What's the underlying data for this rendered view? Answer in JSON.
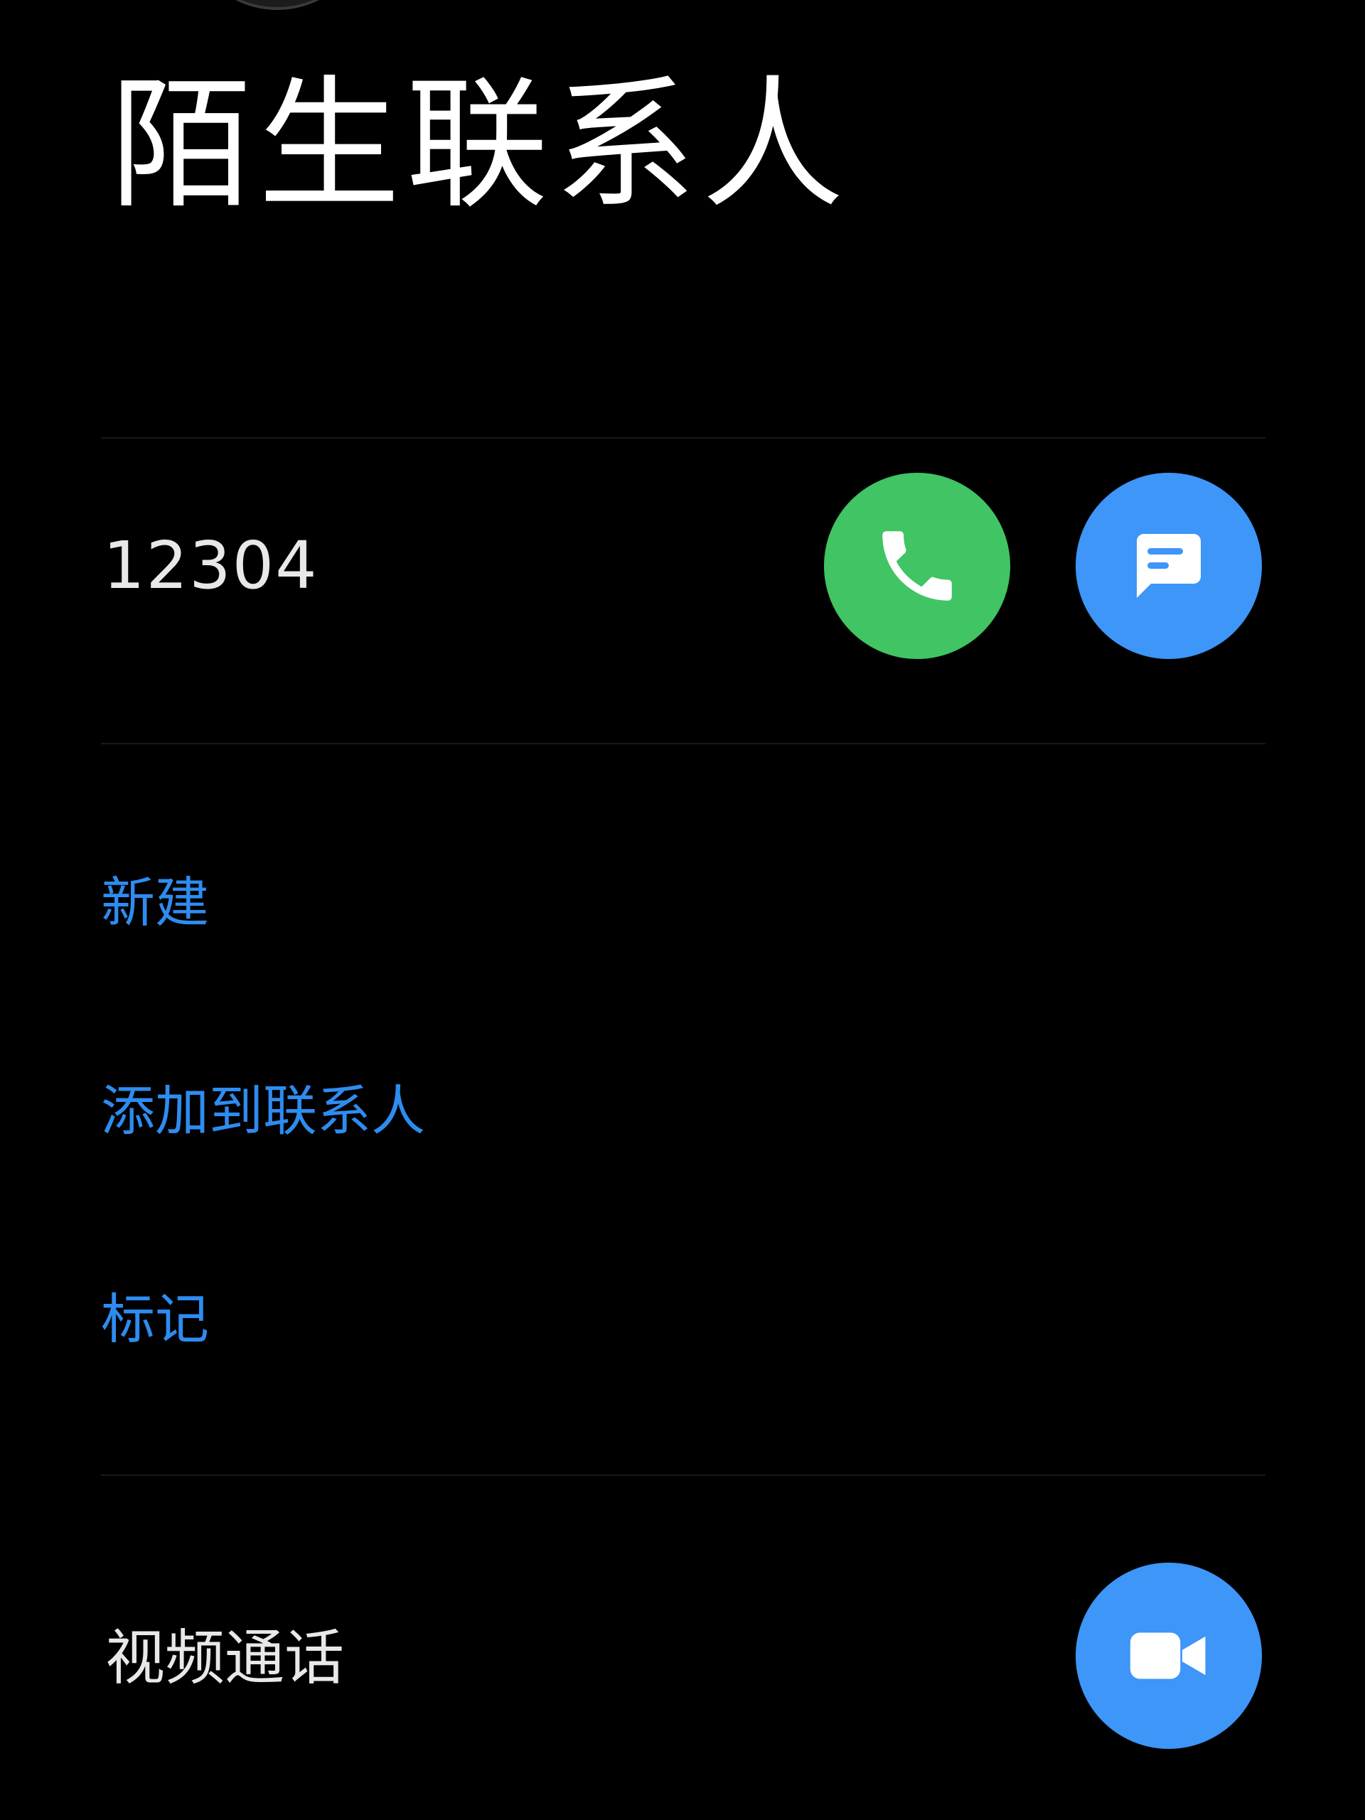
{
  "header": {
    "title": "陌生联系人"
  },
  "phone": {
    "number": "12304",
    "call_icon": "phone-icon",
    "message_icon": "message-icon",
    "call_color": "#41c463",
    "message_color": "#3d96f8"
  },
  "actions": [
    {
      "label": "新建"
    },
    {
      "label": "添加到联系人"
    },
    {
      "label": "标记"
    }
  ],
  "video": {
    "label": "视频通话",
    "icon": "video-camera-icon",
    "color": "#3d96f8"
  },
  "colors": {
    "background": "#000000",
    "accent_link": "#2e8cf0",
    "text_primary": "#ffffff"
  }
}
